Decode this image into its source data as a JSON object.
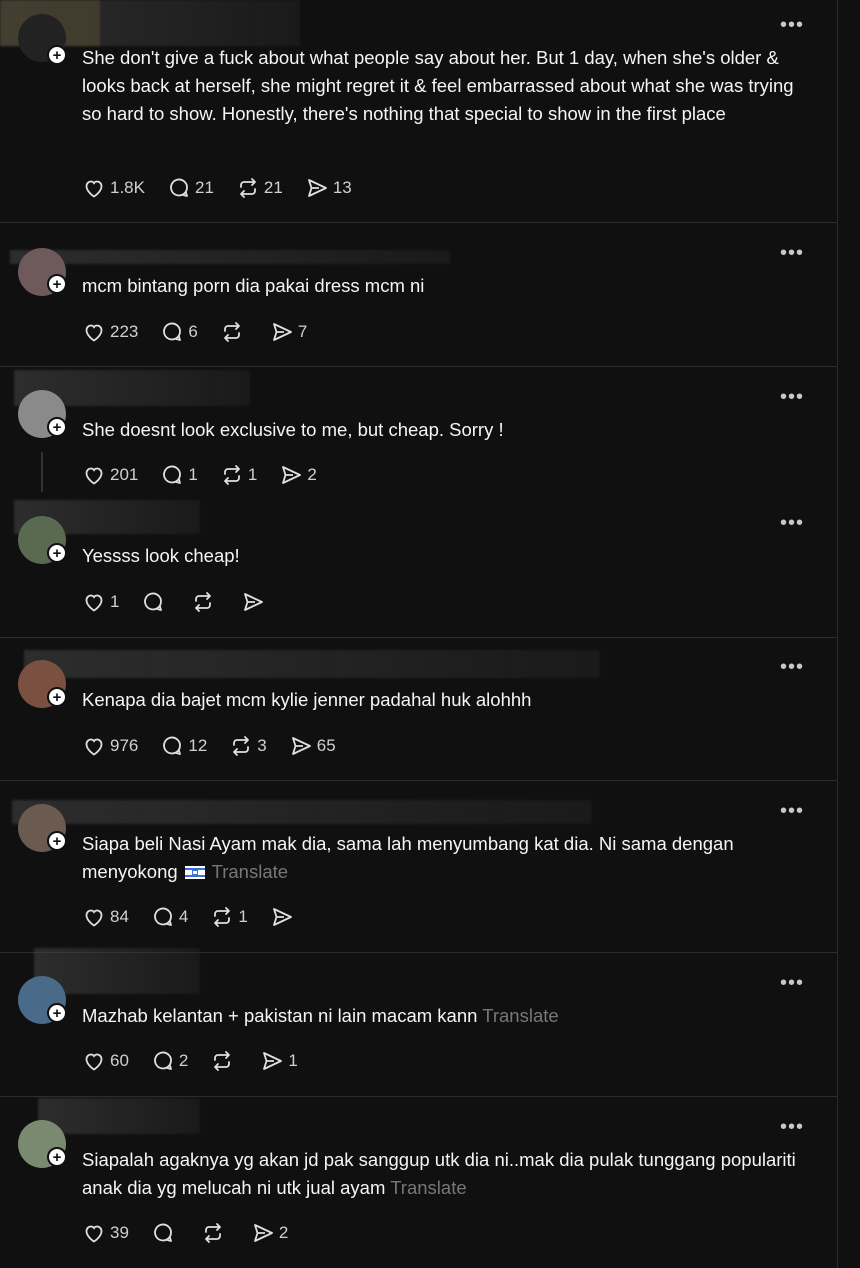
{
  "more_label": "•••",
  "plus_label": "+",
  "posts": [
    {
      "text": "She don't give a fuck about what people say about her. But 1 day, when she's older & looks back at herself, she might regret it & feel embarrassed about what she was trying so hard to show. Honestly, there's nothing that special to show in the first place",
      "translate": "",
      "likes": "1.8K",
      "replies": "21",
      "reposts": "21",
      "shares": "13"
    },
    {
      "text": "mcm bintang porn dia pakai dress mcm ni",
      "translate": "",
      "likes": "223",
      "replies": "6",
      "reposts": "",
      "shares": "7"
    },
    {
      "text": "She doesnt look exclusive to me, but cheap. Sorry !",
      "translate": "",
      "likes": "201",
      "replies": "1",
      "reposts": "1",
      "shares": "2"
    },
    {
      "text": "Yessss look cheap!",
      "translate": "",
      "likes": "1",
      "replies": "",
      "reposts": "",
      "shares": ""
    },
    {
      "text": "Kenapa dia bajet mcm kylie jenner padahal huk alohhh",
      "translate": "",
      "likes": "976",
      "replies": "12",
      "reposts": "3",
      "shares": "65"
    },
    {
      "text": "Siapa beli Nasi Ayam mak dia, sama lah menyumbang kat dia. Ni sama dengan menyokong",
      "translate": "Translate",
      "likes": "84",
      "replies": "4",
      "reposts": "1",
      "shares": ""
    },
    {
      "text": "Mazhab kelantan + pakistan ni lain macam kann",
      "translate": "Translate",
      "likes": "60",
      "replies": "2",
      "reposts": "",
      "shares": "1"
    },
    {
      "text": "Siapalah agaknya yg akan jd pak sanggup utk dia ni..mak dia pulak tunggang populariti anak dia yg melucah ni utk jual ayam",
      "translate": "Translate",
      "likes": "39",
      "replies": "",
      "reposts": "",
      "shares": "2"
    }
  ],
  "colors": {
    "background": "#101010",
    "text": "#f3f5f7",
    "muted": "#777777",
    "divider": "#2d2d2d"
  }
}
